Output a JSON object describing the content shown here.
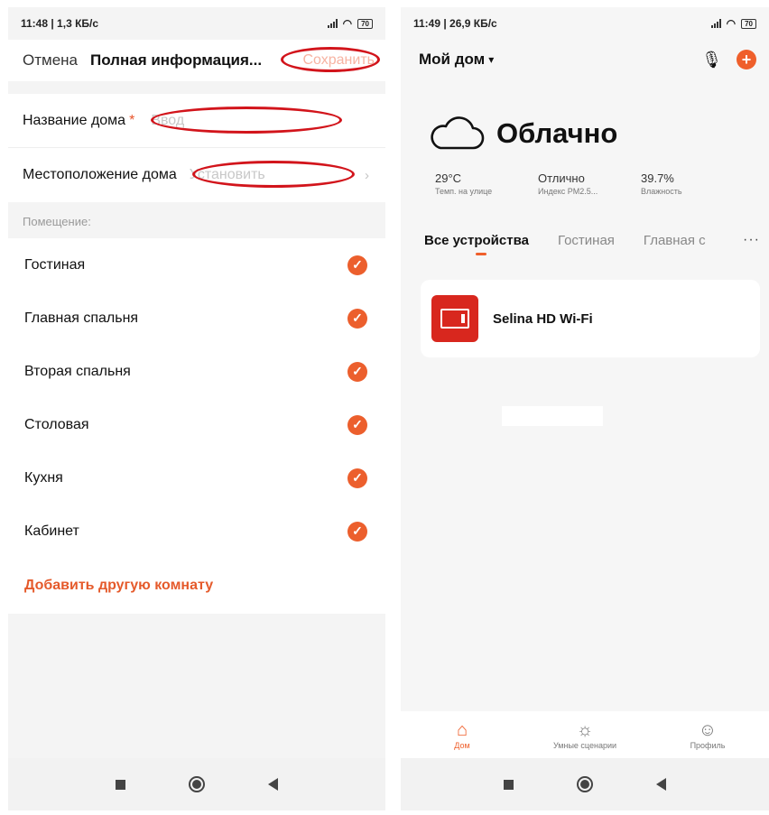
{
  "left": {
    "status": {
      "time": "11:48 | 1,3 КБ/с",
      "battery": "70"
    },
    "header": {
      "cancel": "Отмена",
      "title": "Полная информация...",
      "save": "Сохранить"
    },
    "home_name": {
      "label": "Название дома",
      "required": "*",
      "placeholder": "Ввод"
    },
    "home_location": {
      "label": "Местоположение дома",
      "value": "Установить"
    },
    "rooms_label": "Помещение:",
    "rooms": [
      "Гостиная",
      "Главная спальня",
      "Вторая спальня",
      "Столовая",
      "Кухня",
      "Кабинет"
    ],
    "add_room": "Добавить другую комнату",
    "accent": "#ec5f2d",
    "annotation_color": "#d2141b"
  },
  "right": {
    "status": {
      "time": "11:49 | 26,9 КБ/с",
      "battery": "70"
    },
    "header": {
      "home": "Мой дом"
    },
    "weather": {
      "condition": "Облачно"
    },
    "stats": [
      {
        "value": "29°C",
        "label": "Темп. на улице"
      },
      {
        "value": "Отлично",
        "label": "Индекс PM2.5..."
      },
      {
        "value": "39.7%",
        "label": "Влажность"
      }
    ],
    "tabs": [
      "Все устройства",
      "Гостиная",
      "Главная с"
    ],
    "device": {
      "name": "Selina HD Wi-Fi"
    },
    "bottom_tabs": [
      {
        "label": "Дом",
        "icon": "home-icon"
      },
      {
        "label": "Умные сценарии",
        "icon": "sun-icon"
      },
      {
        "label": "Профиль",
        "icon": "profile-icon"
      }
    ],
    "accent": "#ef5f2b"
  }
}
